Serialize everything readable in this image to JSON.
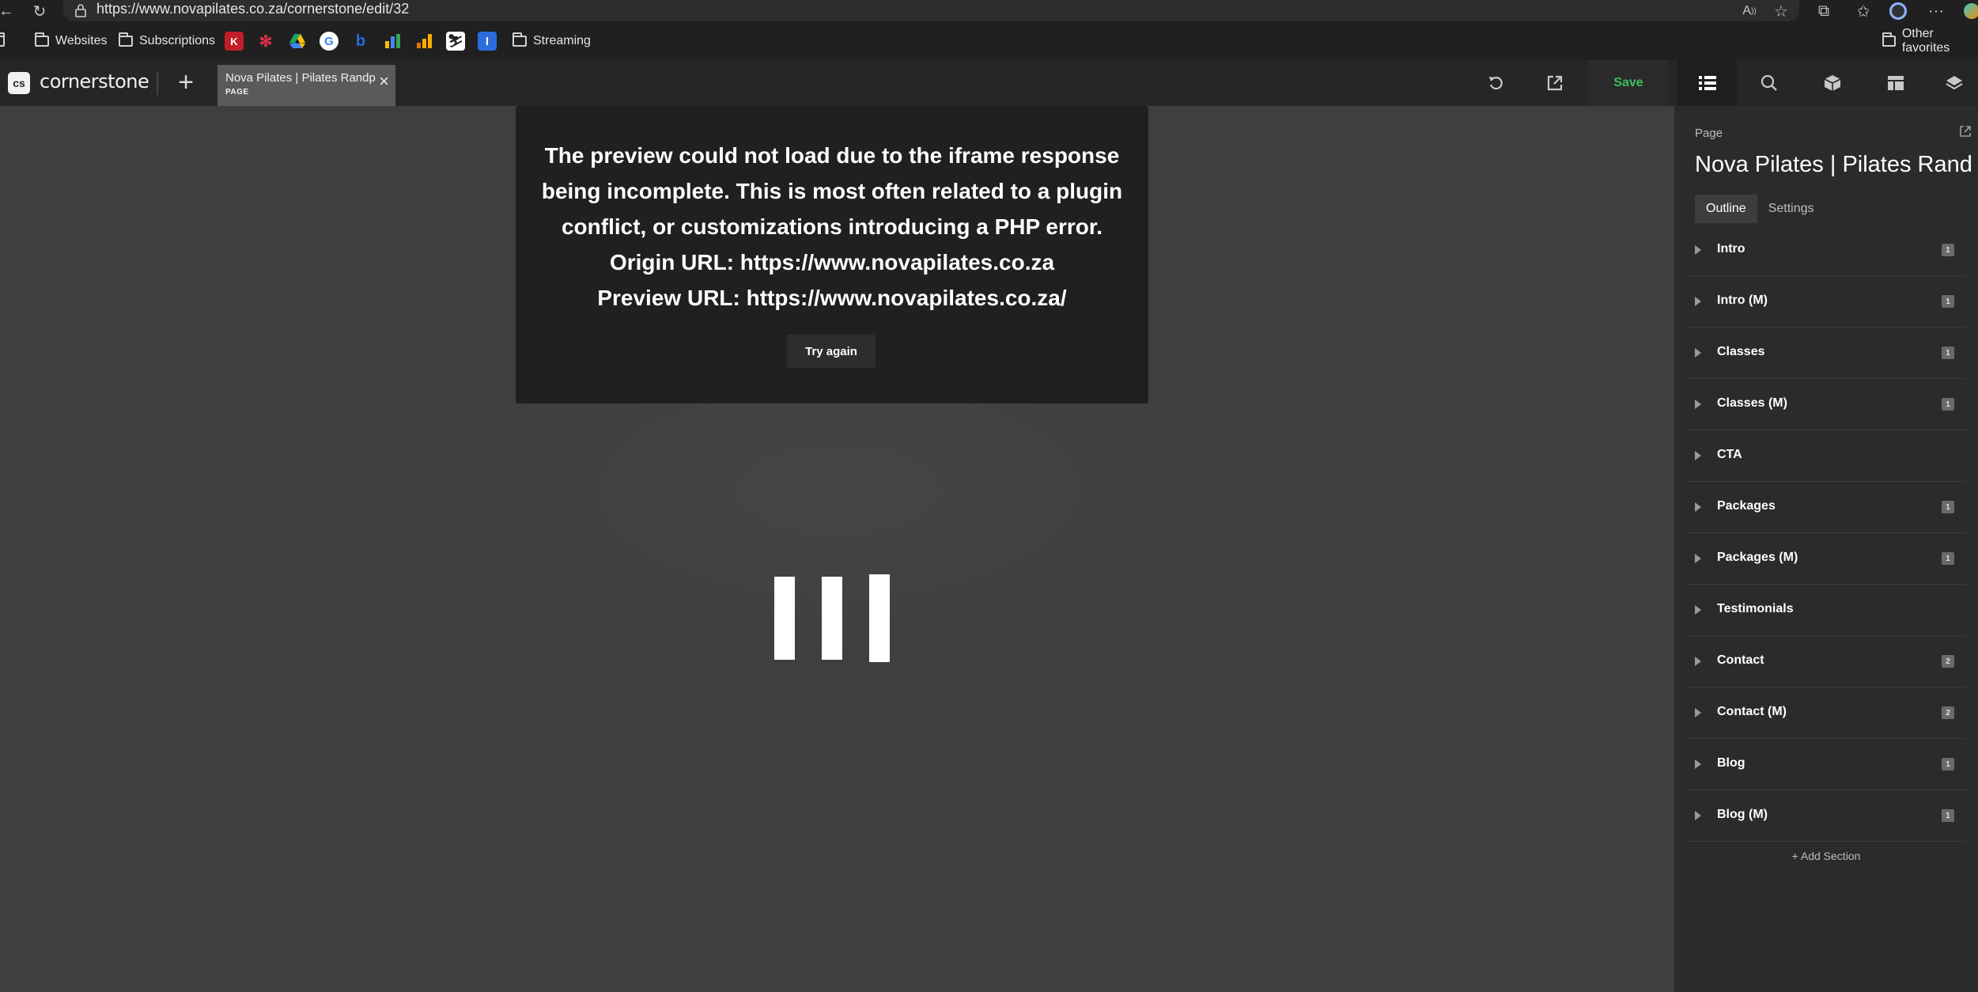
{
  "browser": {
    "url": "https://www.novapilates.co.za/cornerstone/edit/32",
    "bookmarks": [
      {
        "label": "Websites"
      },
      {
        "label": "Subscriptions"
      },
      {
        "label": "Streaming"
      }
    ],
    "other_favorites": "Other favorites"
  },
  "builder": {
    "brand": "cornerstone",
    "logo_text": "cs",
    "tab": {
      "title": "Nova Pilates | Pilates Randpark",
      "type": "PAGE"
    },
    "save_label": "Save"
  },
  "error": {
    "lines": [
      "The preview could not load due to the iframe response",
      "being incomplete. This is most often related to a plugin",
      "conflict, or customizations introducing a PHP error.",
      "Origin URL: https://www.novapilates.co.za",
      "Preview URL: https://www.novapilates.co.za/"
    ],
    "button": "Try again"
  },
  "panel": {
    "kind": "Page",
    "title": "Nova Pilates | Pilates Randpark",
    "tabs": [
      "Outline",
      "Settings"
    ],
    "sections": [
      {
        "label": "Intro",
        "badge": "1"
      },
      {
        "label": "Intro (M)",
        "badge": "1"
      },
      {
        "label": "Classes",
        "badge": "1"
      },
      {
        "label": "Classes (M)",
        "badge": "1"
      },
      {
        "label": "CTA",
        "badge": ""
      },
      {
        "label": "Packages",
        "badge": "1"
      },
      {
        "label": "Packages (M)",
        "badge": "1"
      },
      {
        "label": "Testimonials",
        "badge": ""
      },
      {
        "label": "Contact",
        "badge": "2"
      },
      {
        "label": "Contact (M)",
        "badge": "2"
      },
      {
        "label": "Blog",
        "badge": "1"
      },
      {
        "label": "Blog (M)",
        "badge": "1"
      }
    ],
    "add_section": "+ Add Section"
  }
}
